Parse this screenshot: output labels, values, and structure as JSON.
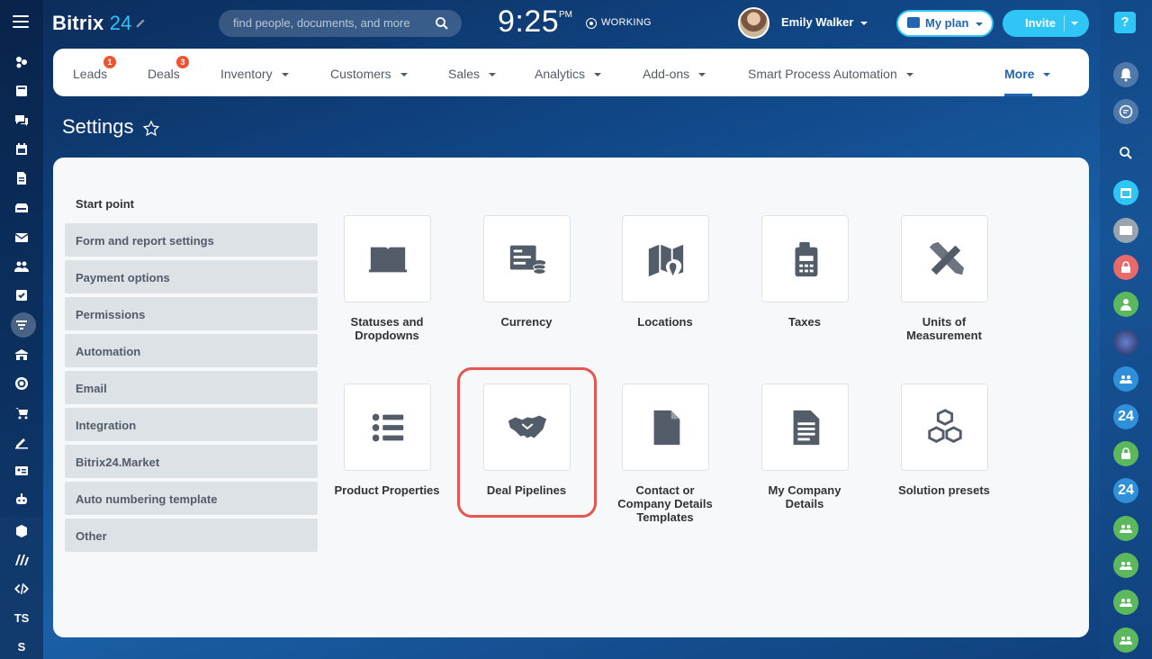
{
  "app": {
    "logo_text": "Bitrix",
    "logo_num": "24",
    "search_placeholder": "find people, documents, and more",
    "clock": "9:25",
    "clock_ampm": "PM",
    "work_status": "WORKING",
    "user_name": "Emily Walker",
    "plan_label": "My plan",
    "invite_label": "Invite",
    "help_label": "?"
  },
  "left_sidebar": {
    "text_items": [
      "TS",
      "S"
    ]
  },
  "topnav": {
    "items": [
      {
        "label": "Leads",
        "badge": "1"
      },
      {
        "label": "Deals",
        "badge": "3"
      },
      {
        "label": "Inventory"
      },
      {
        "label": "Customers"
      },
      {
        "label": "Sales"
      },
      {
        "label": "Analytics"
      },
      {
        "label": "Add-ons"
      },
      {
        "label": "Smart Process Automation"
      },
      {
        "label": "More"
      }
    ]
  },
  "page": {
    "title": "Settings"
  },
  "settings_menu": {
    "heading": "Start point",
    "items": [
      "Form and report settings",
      "Payment options",
      "Permissions",
      "Automation",
      "Email",
      "Integration",
      "Bitrix24.Market",
      "Auto numbering template",
      "Other"
    ]
  },
  "tiles": [
    {
      "label_1": "Statuses and",
      "label_2": "Dropdowns",
      "icon": "book-icon"
    },
    {
      "label_1": "Currency",
      "icon": "currency-icon"
    },
    {
      "label_1": "Locations",
      "icon": "map-icon"
    },
    {
      "label_1": "Taxes",
      "icon": "calculator-icon"
    },
    {
      "label_1": "Units of",
      "label_2": "Measurement",
      "icon": "ruler-pencil-icon"
    },
    {
      "label_1": "Product Properties",
      "icon": "list-icon"
    },
    {
      "label_1": "Deal Pipelines",
      "icon": "handshake-icon"
    },
    {
      "label_1": "Contact or",
      "label_2": "Company Details",
      "label_3": "Templates",
      "icon": "document-icon"
    },
    {
      "label_1": "My Company",
      "label_2": "Details",
      "icon": "file-text-icon"
    },
    {
      "label_1": "Solution presets",
      "icon": "cubes-icon"
    }
  ],
  "right_sidebar": {
    "badge_24": "24"
  },
  "colors": {
    "accent": "#2fc6f6",
    "brand_blue": "#2066b0",
    "badge_red": "#f0542e",
    "highlight": "#e4564f"
  }
}
